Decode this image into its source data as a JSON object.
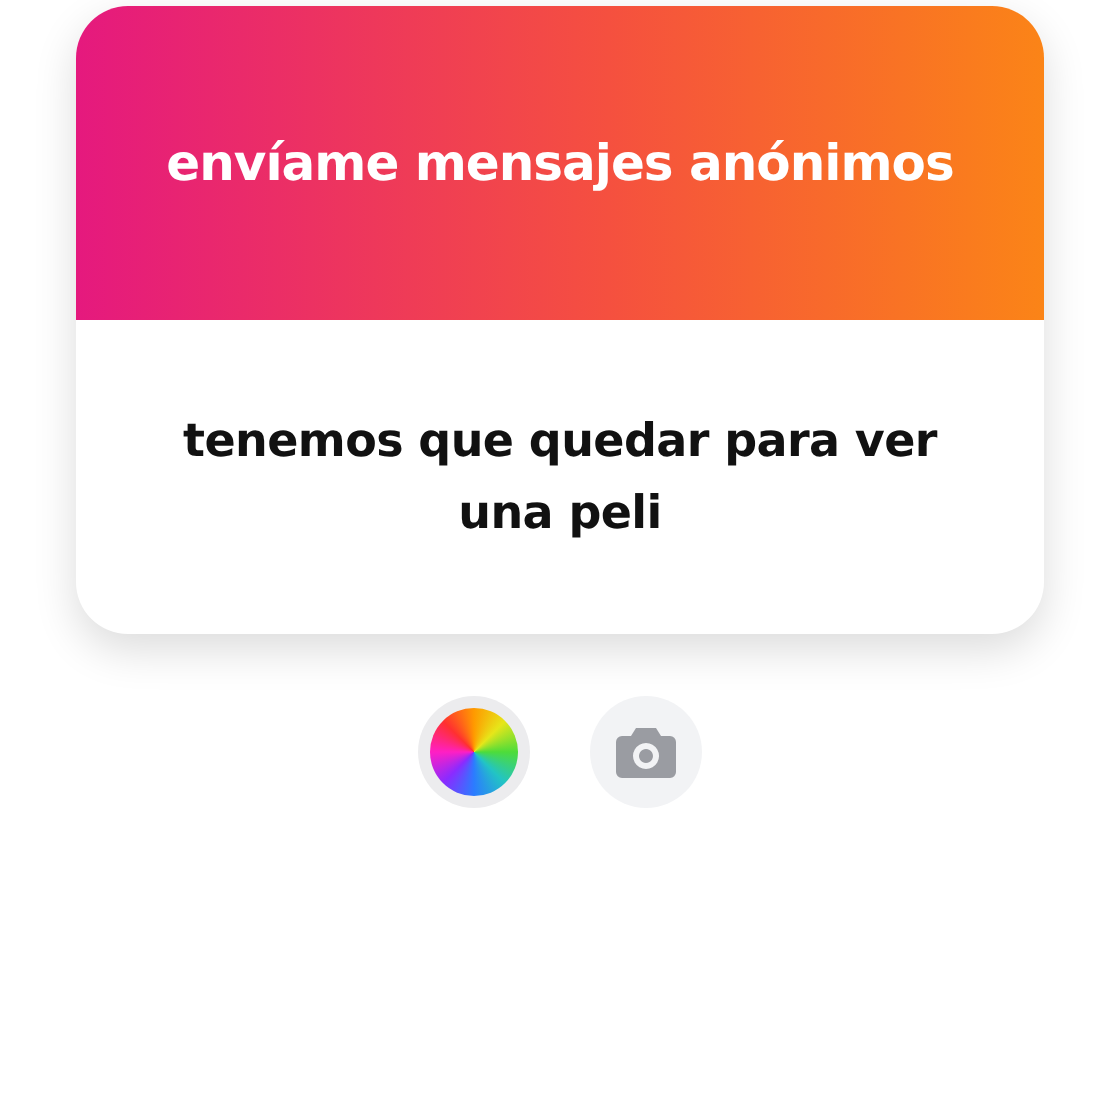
{
  "card": {
    "title": "envíame mensajes anónimos",
    "message": "tenemos que quedar para ver una peli"
  }
}
